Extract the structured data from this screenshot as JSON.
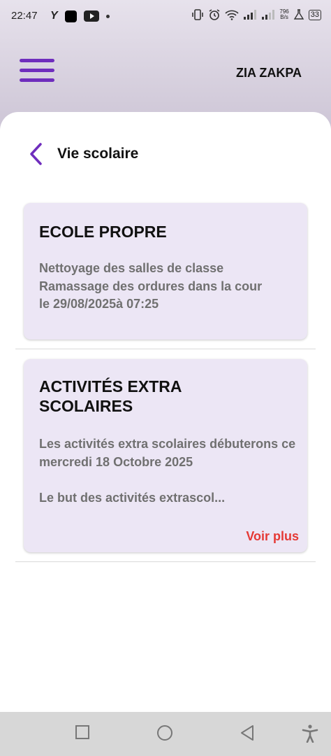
{
  "status_bar": {
    "time": "22:47",
    "network_speed_value": "796",
    "network_speed_unit": "B/s",
    "battery": "33",
    "icons": [
      "y-app-icon",
      "black-square-app-icon",
      "youtube-icon",
      "dot-icon",
      "vibrate-icon",
      "alarm-icon",
      "wifi-icon",
      "signal-icon",
      "signal-icon",
      "lab-flask-icon",
      "battery-icon"
    ]
  },
  "app_bar": {
    "user_name": "ZIA ZAKPA",
    "accent_color": "#6f2dbd"
  },
  "page": {
    "title": "Vie scolaire"
  },
  "cards": [
    {
      "title": "ECOLE PROPRE",
      "body": "Nettoyage des salles de classe\nRamassage des ordures dans la cour\n le 29/08/2025à 07:25"
    },
    {
      "title": "ACTIVITÉS EXTRA SCOLAIRES",
      "body": "Les activités extra scolaires débuterons ce mercredi 18 Octobre 2025\n\nLe but des activités extrascol...",
      "more_label": "Voir plus",
      "more_color": "#e53935"
    }
  ],
  "nav_bar": {
    "icons": [
      "recent-apps-icon",
      "home-icon",
      "back-icon",
      "accessibility-icon"
    ]
  }
}
